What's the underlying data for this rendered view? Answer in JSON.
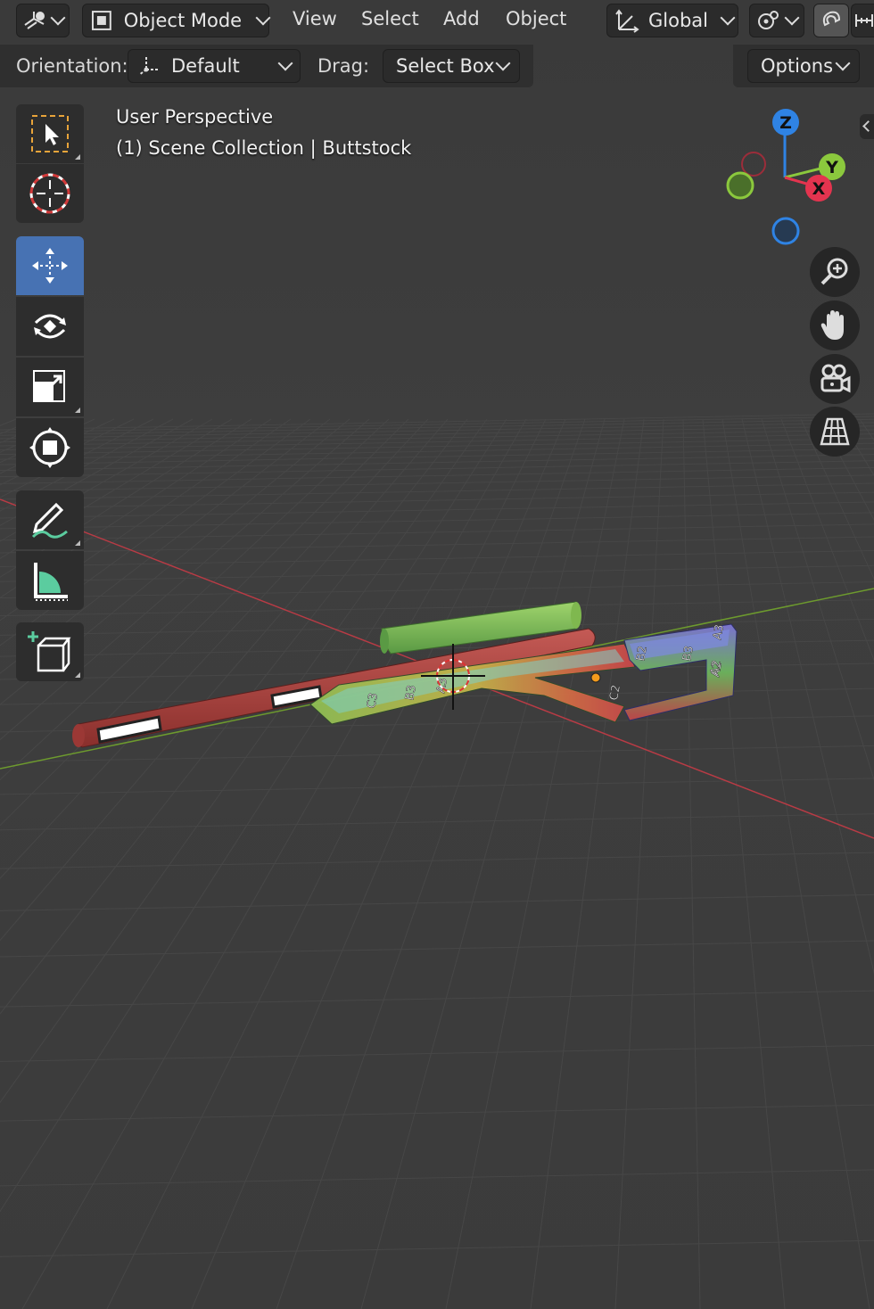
{
  "header": {
    "mode": {
      "label": "Object Mode"
    },
    "menus": [
      "View",
      "Select",
      "Add",
      "Object"
    ],
    "transform_orientation": "Global"
  },
  "toolbar_settings": {
    "orientation_label": "Orientation:",
    "orientation_value": "Default",
    "drag_label": "Drag:",
    "drag_value": "Select Box",
    "options_label": "Options"
  },
  "viewport_overlay": {
    "perspective": "User Perspective",
    "collection": "(1) Scene Collection | Buttstock"
  },
  "gizmo": {
    "axes": [
      "Z",
      "Y",
      "X"
    ],
    "colors": {
      "x": "#e4344f",
      "y": "#8bc83d",
      "z": "#2f83e4"
    }
  },
  "tools": [
    {
      "name": "select-box-tool",
      "icon": "select-box-icon",
      "active": false
    },
    {
      "name": "cursor-tool",
      "icon": "cursor-icon",
      "active": false
    },
    {
      "name": "move-tool",
      "icon": "move-icon",
      "active": true
    },
    {
      "name": "rotate-tool",
      "icon": "rotate-icon",
      "active": false
    },
    {
      "name": "scale-tool",
      "icon": "scale-icon",
      "active": false
    },
    {
      "name": "transform-tool",
      "icon": "transform-icon",
      "active": false
    },
    {
      "name": "annotate-tool",
      "icon": "annotate-icon",
      "active": false
    },
    {
      "name": "measure-tool",
      "icon": "measure-icon",
      "active": false
    },
    {
      "name": "add-cube-tool",
      "icon": "add-cube-icon",
      "active": false
    }
  ],
  "nav_buttons": [
    "zoom-icon",
    "pan-hand-icon",
    "camera-icon",
    "grid-perspective-icon"
  ],
  "uv_labels": [
    "C3",
    "B3",
    "A3",
    "B2",
    "A2",
    "B3",
    "A3",
    "C2",
    "A2"
  ],
  "colors": {
    "accent": "#4772b3",
    "background": "#3d3d3d",
    "panel": "#2b2b2b"
  }
}
